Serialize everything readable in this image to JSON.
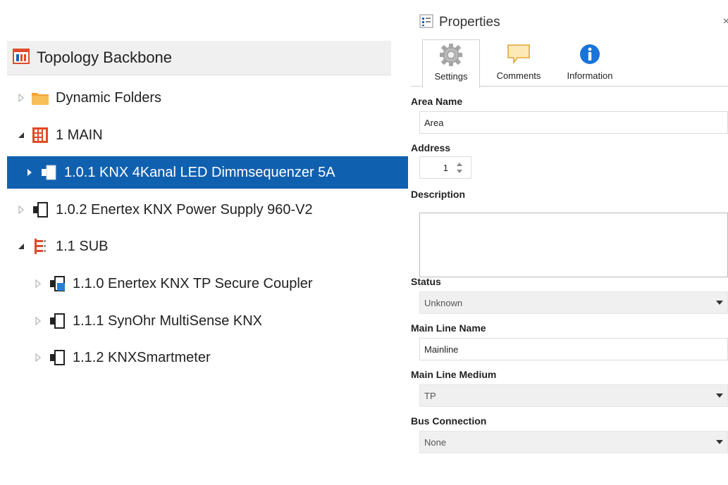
{
  "topology": {
    "title": "Topology Backbone",
    "rows": [
      {
        "label": "Dynamic Folders",
        "expanded": false,
        "icon": "folder-icon"
      },
      {
        "label": "1 MAIN",
        "expanded": true,
        "icon": "area-icon"
      },
      {
        "label": "1.0.1 KNX 4Kanal LED Dimmsequenzer 5A",
        "expanded": false,
        "selected": true,
        "icon": "device-icon"
      },
      {
        "label": "1.0.2 Enertex KNX Power Supply 960-V2",
        "expanded": false,
        "icon": "device-icon"
      },
      {
        "label": "1.1 SUB",
        "expanded": true,
        "icon": "line-icon"
      },
      {
        "label": "1.1.0 Enertex KNX TP Secure Coupler",
        "expanded": false,
        "icon": "coupler-icon"
      },
      {
        "label": "1.1.1 SynOhr MultiSense KNX",
        "expanded": false,
        "icon": "device-icon"
      },
      {
        "label": "1.1.2 KNXSmartmeter",
        "expanded": false,
        "icon": "device-icon"
      }
    ],
    "colors": {
      "selected_bg": "#1060b0",
      "area_icon": "#e04a28",
      "folder": "#f3a532"
    }
  },
  "properties": {
    "title": "Properties",
    "close_glyph": "×",
    "tabs": [
      {
        "label": "Settings",
        "icon": "gear-icon",
        "active": true
      },
      {
        "label": "Comments",
        "icon": "comment-icon",
        "active": false
      },
      {
        "label": "Information",
        "icon": "info-icon",
        "active": false
      }
    ],
    "fields": {
      "area_name": {
        "label": "Area Name",
        "value": "Area"
      },
      "address": {
        "label": "Address",
        "value": "1"
      },
      "description": {
        "label": "Description",
        "value": ""
      },
      "status": {
        "label": "Status",
        "value": "Unknown"
      },
      "main_line_name": {
        "label": "Main Line Name",
        "value": "Mainline"
      },
      "main_line_medium": {
        "label": "Main Line Medium",
        "value": "TP"
      },
      "bus_connection": {
        "label": "Bus Connection",
        "value": "None"
      }
    },
    "colors": {
      "info_icon": "#1a73d9",
      "comment_icon": "#f2c14e"
    }
  }
}
